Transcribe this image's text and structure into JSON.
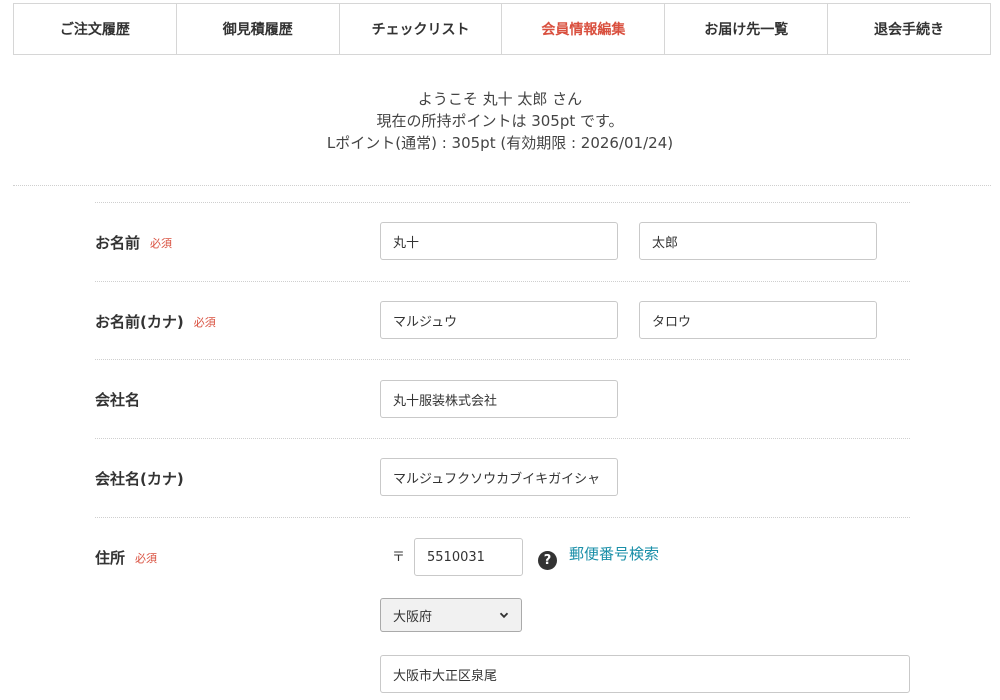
{
  "tabs": [
    {
      "label": "ご注文履歴"
    },
    {
      "label": "御見積履歴"
    },
    {
      "label": "チェックリスト"
    },
    {
      "label": "会員情報編集",
      "active": true
    },
    {
      "label": "お届け先一覧"
    },
    {
      "label": "退会手続き"
    }
  ],
  "welcome": {
    "line1": "ようこそ 丸十 太郎 さん",
    "line2": "現在の所持ポイントは 305pt です。",
    "line3": "Lポイント(通常) : 305pt (有効期限 : 2026/01/24)"
  },
  "required_label": "必須",
  "form": {
    "name": {
      "label": "お名前",
      "last": "丸十",
      "first": "太郎"
    },
    "name_kana": {
      "label": "お名前(カナ)",
      "last": "マルジュウ",
      "first": "タロウ"
    },
    "company": {
      "label": "会社名",
      "value": "丸十服装株式会社"
    },
    "company_kana": {
      "label": "会社名(カナ)",
      "value": "マルジュフクソウカブイキガイシャ"
    },
    "address": {
      "label": "住所",
      "zip_mark": "〒",
      "zip": "5510031",
      "zip_search_link": "郵便番号検索",
      "prefecture": "大阪府",
      "city": "大阪市大正区泉尾"
    }
  },
  "icons": {
    "help": "question-circle-icon",
    "select_arrow": "chevron-down-icon"
  },
  "colors": {
    "accent": "#d9503f",
    "link": "#1a8fa8"
  }
}
